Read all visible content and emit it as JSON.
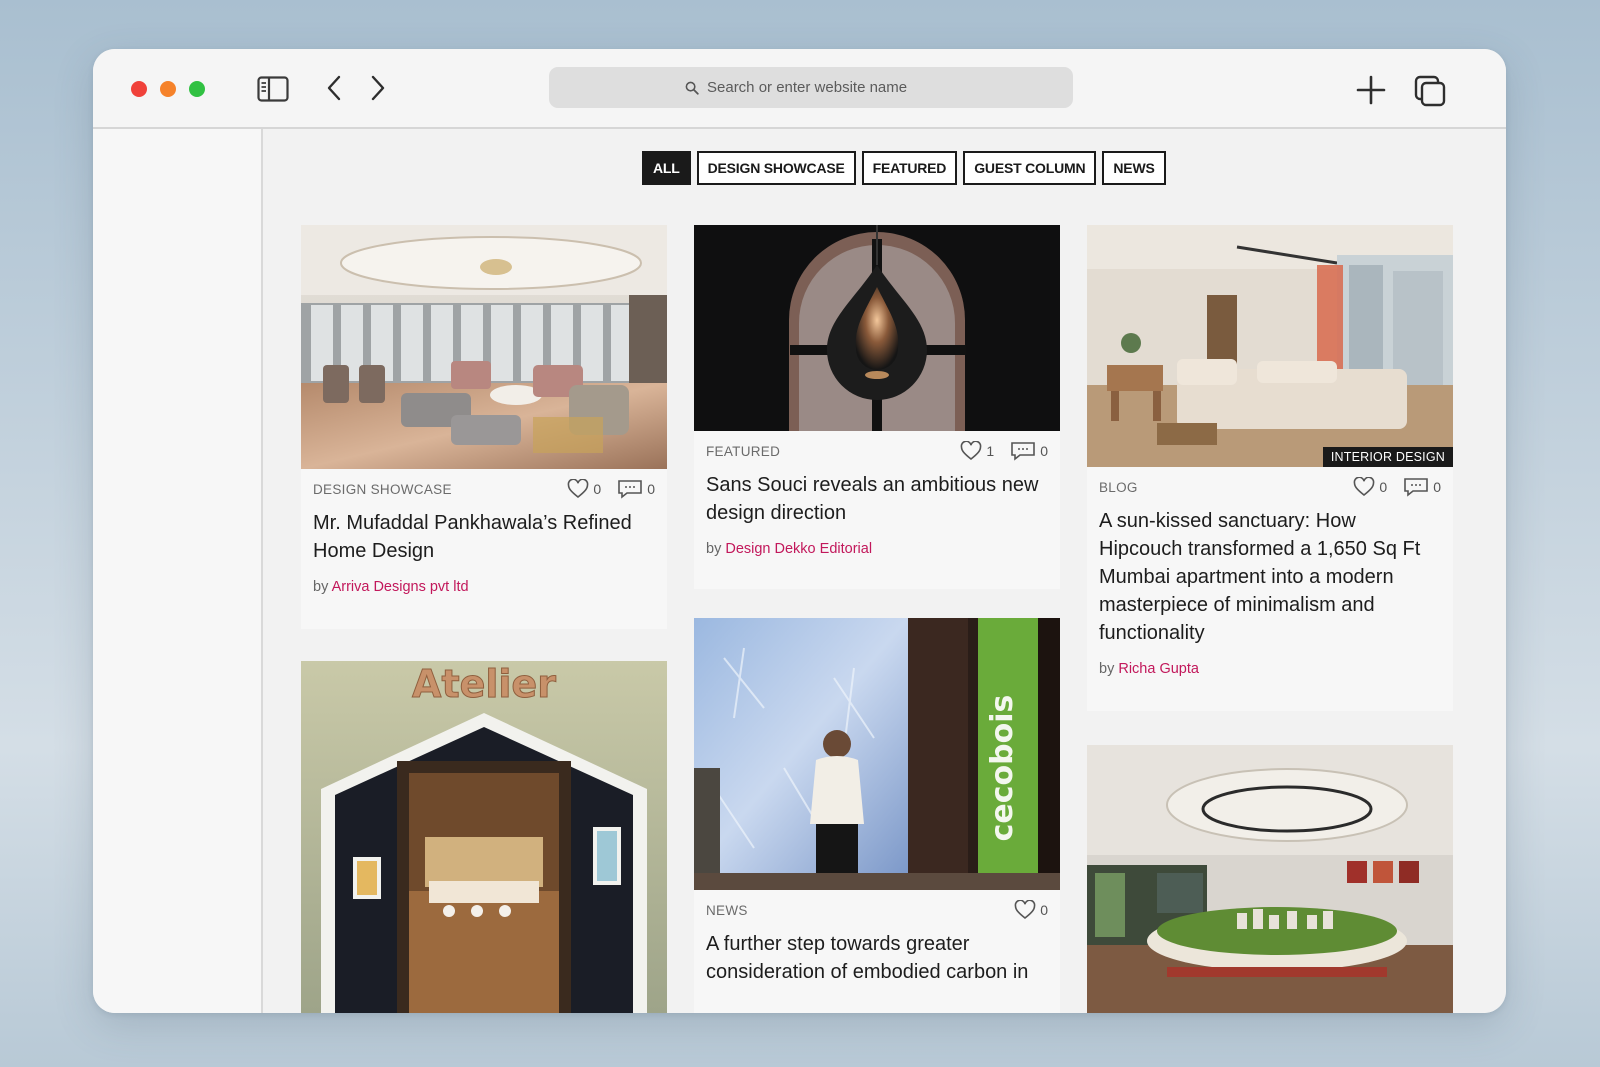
{
  "browser": {
    "search_placeholder": "Search or enter website name",
    "icons": {
      "sidebar": "sidebar-icon",
      "back": "chevron-left-icon",
      "forward": "chevron-right-icon",
      "new_tab": "plus-icon",
      "tabs": "tabs-overview-icon",
      "search": "search-icon"
    },
    "traffic_colors": {
      "close": "#f0413a",
      "minimize": "#f5822a",
      "zoom": "#31c142"
    }
  },
  "filters": [
    {
      "label": "ALL",
      "active": true
    },
    {
      "label": "DESIGN SHOWCASE",
      "active": false
    },
    {
      "label": "FEATURED",
      "active": false
    },
    {
      "label": "GUEST COLUMN",
      "active": false
    },
    {
      "label": "NEWS",
      "active": false
    }
  ],
  "articles": [
    {
      "category": "DESIGN SHOWCASE",
      "likes": "0",
      "comments": "0",
      "title": "Mr. Mufaddal Pankhawala’s Refined Home Design",
      "by": "by",
      "author": "Arriva Designs pvt ltd",
      "image": "luxury living room interior"
    },
    {
      "category": "FEATURED",
      "likes": "1",
      "comments": "0",
      "title": "Sans Souci reveals an ambitious new design direction",
      "by": "by",
      "author": "Design Dekko Editorial",
      "image": "teardrop pendant lamp"
    },
    {
      "category": "BLOG",
      "likes": "0",
      "comments": "0",
      "title": "A sun-kissed sanctuary: How Hipcouch transformed a 1,650 Sq Ft Mumbai apartment into a modern masterpiece of minimalism and functionality",
      "by": "by",
      "author": "Richa Gupta",
      "badge": "INTERIOR DESIGN",
      "image": "sunlit apartment living room"
    },
    {
      "image": "Atelier kids room house-shaped doorway",
      "sign_text": "Atelier"
    },
    {
      "category": "NEWS",
      "likes": "0",
      "title": "A further step towards greater consideration of embodied carbon in",
      "image": "speaker presenting on stage",
      "banner_text": "cecobois"
    },
    {
      "image": "sales gallery with circular architectural model"
    }
  ],
  "accent_color": "#c2185b"
}
